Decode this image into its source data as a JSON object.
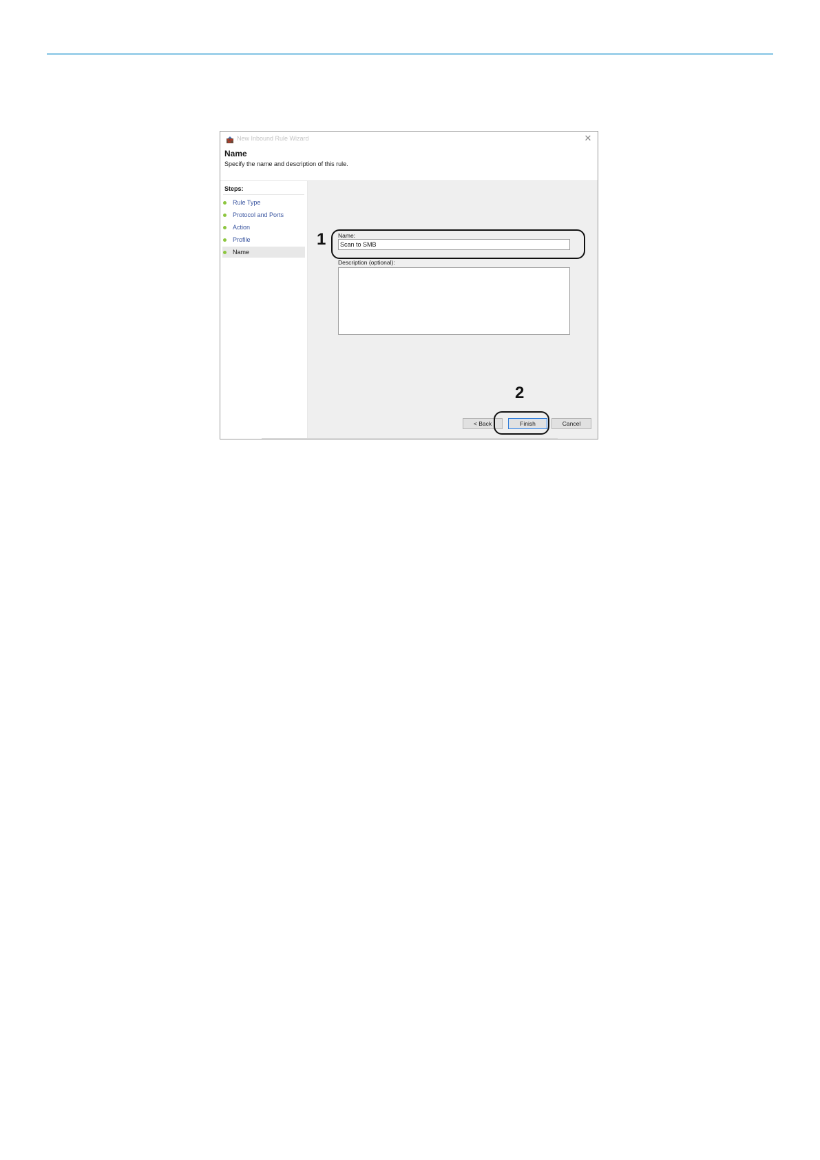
{
  "dialog": {
    "window_title": "New Inbound Rule Wizard",
    "icon": "firewall-wizard-icon",
    "close_label": "✕",
    "heading": "Name",
    "subheading": "Specify the name and description of this rule."
  },
  "steps": {
    "heading": "Steps:",
    "items": [
      {
        "label": "Rule Type",
        "current": false
      },
      {
        "label": "Protocol and Ports",
        "current": false
      },
      {
        "label": "Action",
        "current": false
      },
      {
        "label": "Profile",
        "current": false
      },
      {
        "label": "Name",
        "current": true
      }
    ],
    "dot_color": "#8dc63f"
  },
  "form": {
    "name_label": "Name:",
    "name_value": "Scan to SMB",
    "description_label": "Description (optional):",
    "description_value": ""
  },
  "buttons": {
    "back": "< Back",
    "finish": "Finish",
    "cancel": "Cancel"
  },
  "callouts": {
    "first": "1",
    "second": "2"
  },
  "colors": {
    "accent_rule": "#9fd1ea",
    "link_blue": "#3a55a0",
    "content_bg": "#efefef"
  }
}
